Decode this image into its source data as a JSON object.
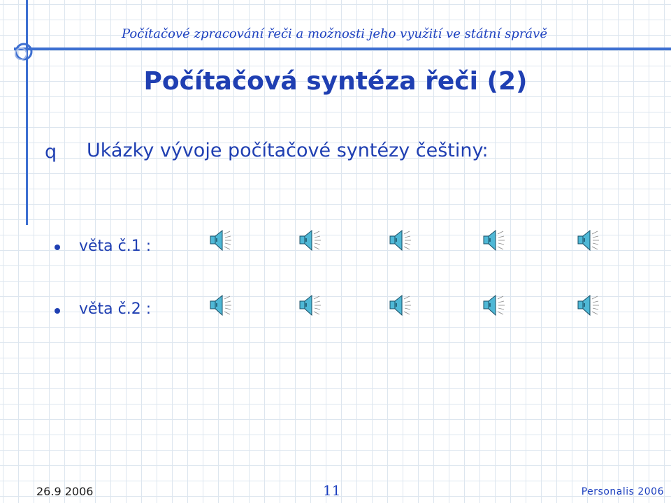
{
  "header": {
    "text": "Počítačové zpracování řeči a možnosti jeho využití ve státní správě"
  },
  "slide": {
    "title": "Počítačová syntéza řeči (2)",
    "main_bullet_symbol": "q",
    "main_text": "Ukázky vývoje počítačové syntézy češtiny:"
  },
  "rows": [
    {
      "label": "věta č.1 :",
      "speakers": [
        "speaker-icon",
        "speaker-icon",
        "speaker-icon",
        "speaker-icon",
        "speaker-icon"
      ]
    },
    {
      "label": "věta č.2 :",
      "speakers": [
        "speaker-icon",
        "speaker-icon",
        "speaker-icon",
        "speaker-icon",
        "speaker-icon"
      ]
    }
  ],
  "footer": {
    "date": "26.9 2006",
    "page": "11",
    "right": "Personalis 2006"
  },
  "colors": {
    "accent": "#3d6fd1",
    "text": "#1f3fb2",
    "speaker": "#4fb8d6"
  }
}
